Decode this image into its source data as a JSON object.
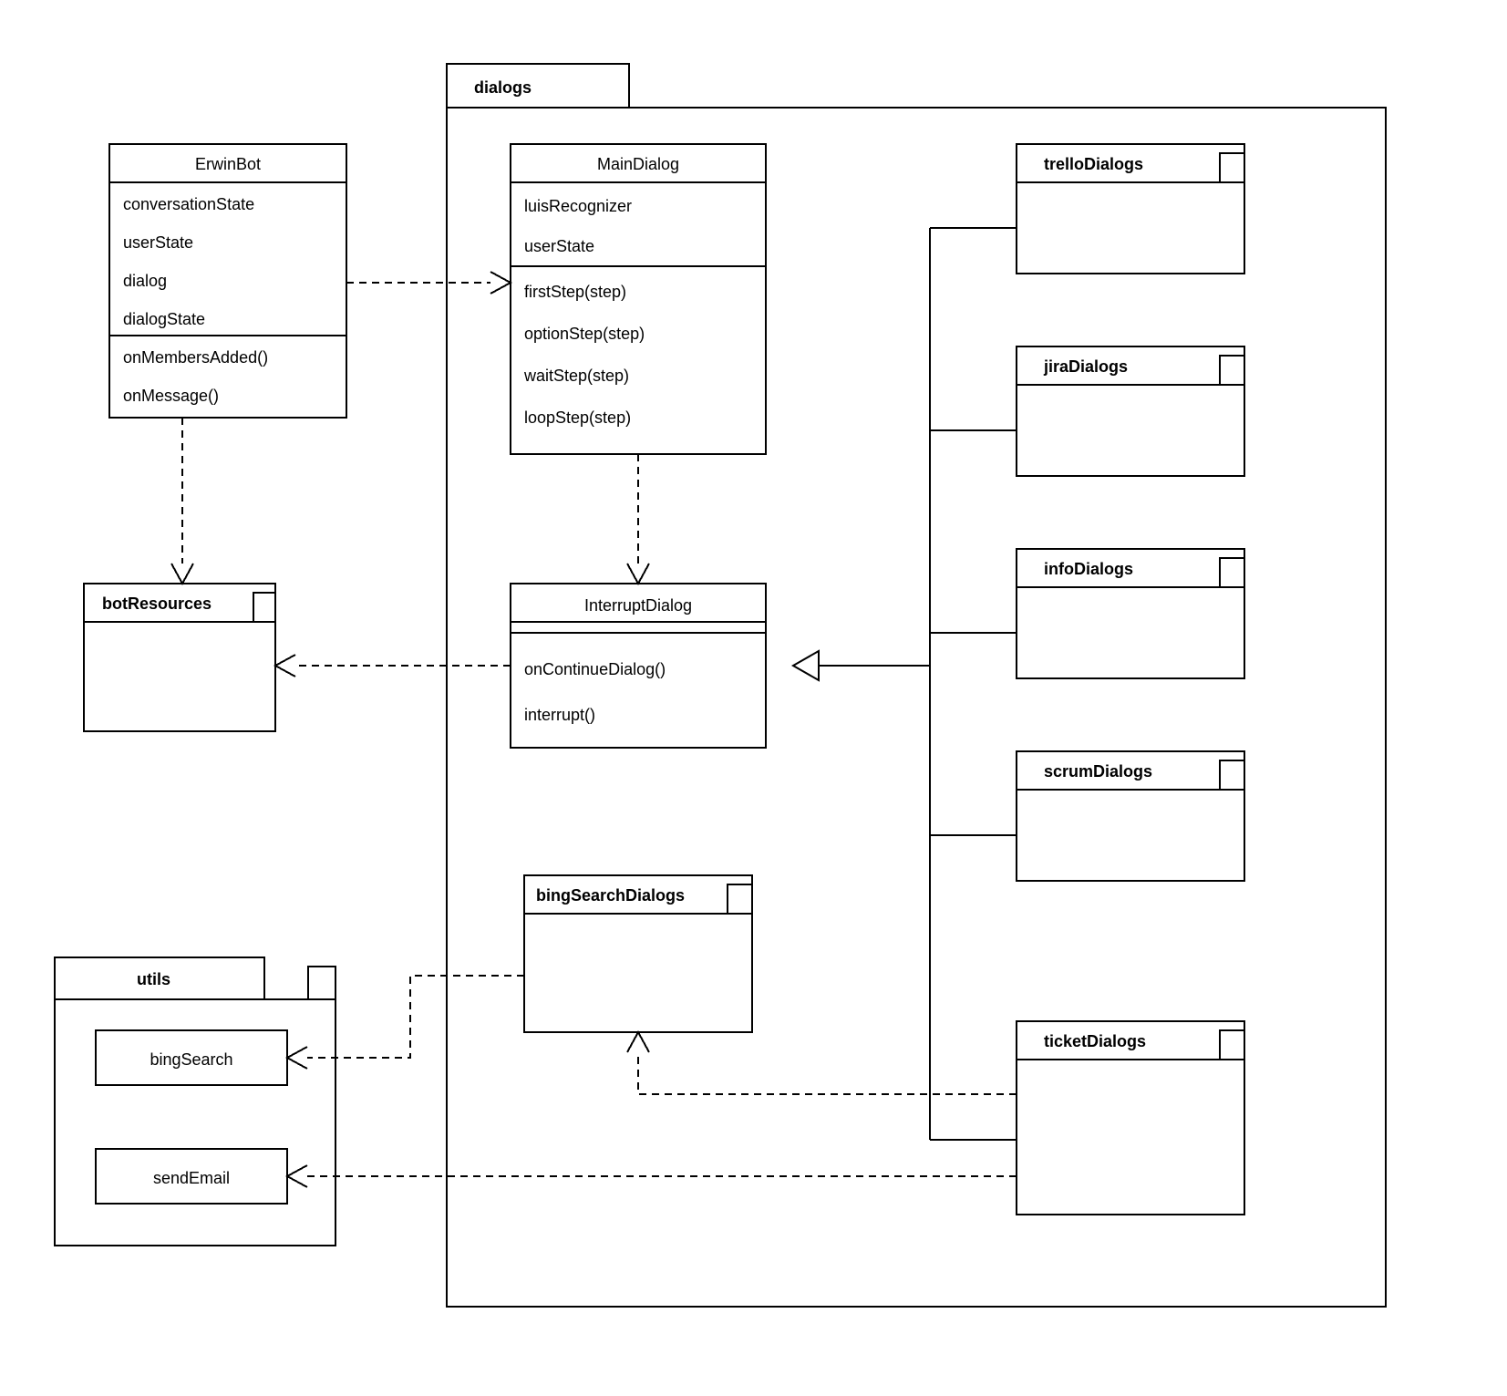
{
  "diagram": {
    "packages": {
      "dialogs": {
        "label": "dialogs"
      },
      "botResources": {
        "label": "botResources"
      },
      "utils": {
        "label": "utils"
      },
      "bingSearchDialogs": {
        "label": "bingSearchDialogs"
      },
      "trelloDialogs": {
        "label": "trelloDialogs"
      },
      "jiraDialogs": {
        "label": "jiraDialogs"
      },
      "infoDialogs": {
        "label": "infoDialogs"
      },
      "scrumDialogs": {
        "label": "scrumDialogs"
      },
      "ticketDialogs": {
        "label": "ticketDialogs"
      }
    },
    "classes": {
      "ErwinBot": {
        "name": "ErwinBot",
        "attributes": [
          "conversationState",
          "userState",
          "dialog",
          "dialogState"
        ],
        "methods": [
          "onMembersAdded()",
          "onMessage()"
        ]
      },
      "MainDialog": {
        "name": "MainDialog",
        "attributes": [
          "luisRecognizer",
          "userState"
        ],
        "methods": [
          "firstStep(step)",
          "optionStep(step)",
          "waitStep(step)",
          "loopStep(step)"
        ]
      },
      "InterruptDialog": {
        "name": "InterruptDialog",
        "attributes": [],
        "methods": [
          "onContinueDialog()",
          "interrupt()"
        ]
      }
    },
    "utilsItems": {
      "bingSearch": {
        "label": "bingSearch"
      },
      "sendEmail": {
        "label": "sendEmail"
      }
    }
  }
}
